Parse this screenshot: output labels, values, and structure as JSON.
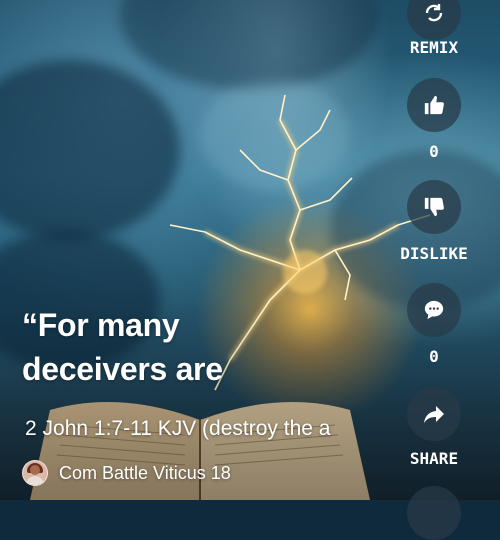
{
  "video": {
    "title": "“For many deceivers are",
    "subtitle": "2 John 1:7-11 KJV (destroy the a",
    "channel_name": "Com Battle Viticus 18"
  },
  "actions": {
    "remix_label": "REMIX",
    "like_count": "0",
    "dislike_label": "DISLIKE",
    "comment_count": "0",
    "share_label": "SHARE"
  },
  "icons": {
    "remix": "remix-icon",
    "like": "thumbs-up-icon",
    "dislike": "thumbs-down-icon",
    "comment": "comment-icon",
    "share": "share-arrow-icon"
  }
}
